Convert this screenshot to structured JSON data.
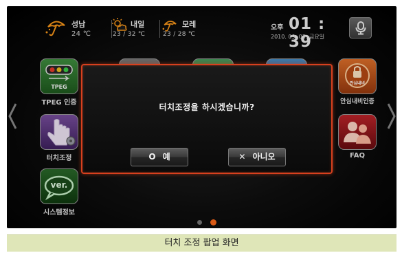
{
  "status_bar": {
    "weather": {
      "today": {
        "location": "성남",
        "temp": "24 ℃",
        "icon": "rain-umbrella-icon"
      },
      "tomorrow": {
        "label": "내일",
        "temp": "23 / 32 ℃",
        "icon": "sun-cloud-icon"
      },
      "day_after": {
        "label": "모레",
        "temp": "23 / 28 ℃",
        "icon": "rain-umbrella-icon"
      }
    },
    "clock": {
      "ampm": "오후",
      "time": "01 : 39",
      "date": "2010. 09. 03. 금요일"
    },
    "voice_button": {
      "icon": "microphone-icon"
    }
  },
  "apps": {
    "tpeg": {
      "label": "TPEG 인증",
      "badge": "TPEG",
      "color": "#2f7a2f"
    },
    "touch": {
      "label": "터치조정",
      "color": "#5c3a80"
    },
    "system": {
      "label": "시스템정보",
      "badge": "ver.",
      "color": "#1e5a1e"
    },
    "safe_nav": {
      "label": "안심내비인증",
      "badge": "안심내비",
      "color": "#d86a24"
    },
    "faq": {
      "label": "FAQ",
      "color": "#b8242a"
    }
  },
  "popup": {
    "message": "터치조정을 하시겠습니까?",
    "yes": {
      "symbol": "O",
      "label": "예"
    },
    "no": {
      "symbol": "✕",
      "label": "아니오"
    },
    "border_color": "#d8401e"
  },
  "pager": {
    "pages": 2,
    "current": 2,
    "active_color": "#ff6a1a"
  },
  "caption": "터치 조정 팝업 화면"
}
